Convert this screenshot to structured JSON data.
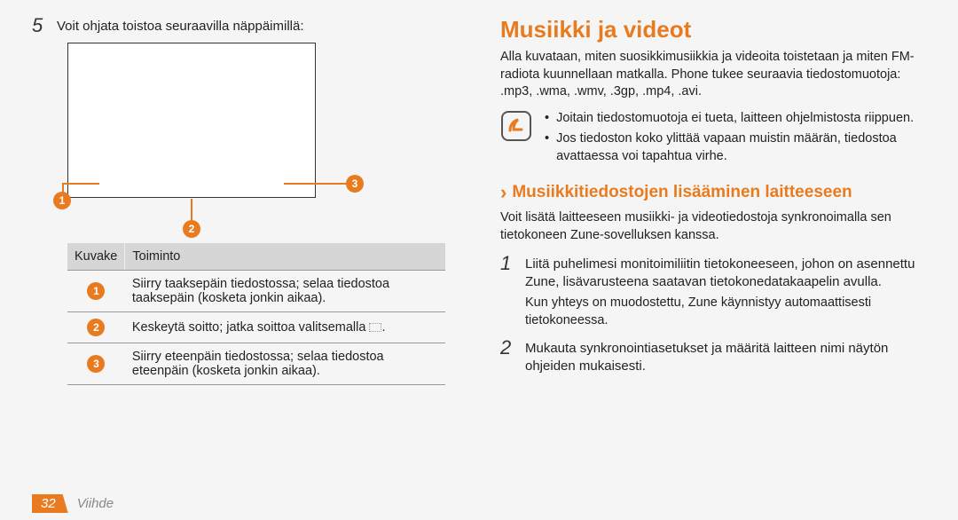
{
  "left": {
    "step5_num": "5",
    "step5_text": "Voit ohjata toistoa seuraavilla näppäimillä:",
    "table": {
      "h1": "Kuvake",
      "h2": "Toiminto",
      "r1": "Siirry taaksepäin tiedostossa; selaa tiedostoa taaksepäin (kosketa jonkin aikaa).",
      "r2a": "Keskeytä soitto; jatka soittoa valitsemalla ",
      "r2b": ".",
      "r3": "Siirry eteenpäin tiedostossa; selaa tiedostoa eteenpäin (kosketa jonkin aikaa)."
    },
    "badges": {
      "b1": "1",
      "b2": "2",
      "b3": "3"
    }
  },
  "right": {
    "title": "Musiikki ja videot",
    "intro": "Alla kuvataan, miten suosikkimusiikkia ja videoita toistetaan ja miten FM-radiota kuunnellaan matkalla. Phone tukee seuraavia tiedostomuotoja: .mp3, .wma, .wmv, .3gp, .mp4, .avi.",
    "notes": {
      "n1": "Joitain tiedostomuotoja ei tueta, laitteen ohjelmistosta riippuen.",
      "n2": "Jos tiedoston koko ylittää vapaan muistin määrän, tiedostoa avattaessa voi tapahtua virhe."
    },
    "sub": "Musiikkitiedostojen lisääminen laitteeseen",
    "sub_intro": "Voit lisätä laitteeseen musiikki- ja videotiedostoja synkronoimalla sen tietokoneen Zune-sovelluksen kanssa.",
    "step1_num": "1",
    "step1_p1": "Liitä puhelimesi monitoimiliitin tietokoneeseen, johon on asennettu Zune, lisävarusteena saatavan tietokonedatakaapelin avulla.",
    "step1_p2": "Kun yhteys on muodostettu, Zune käynnistyy automaattisesti tietokoneessa.",
    "step2_num": "2",
    "step2_p1": "Mukauta synkronointiasetukset ja määritä laitteen nimi näytön ohjeiden mukaisesti."
  },
  "footer": {
    "page": "32",
    "chapter": "Viihde"
  }
}
